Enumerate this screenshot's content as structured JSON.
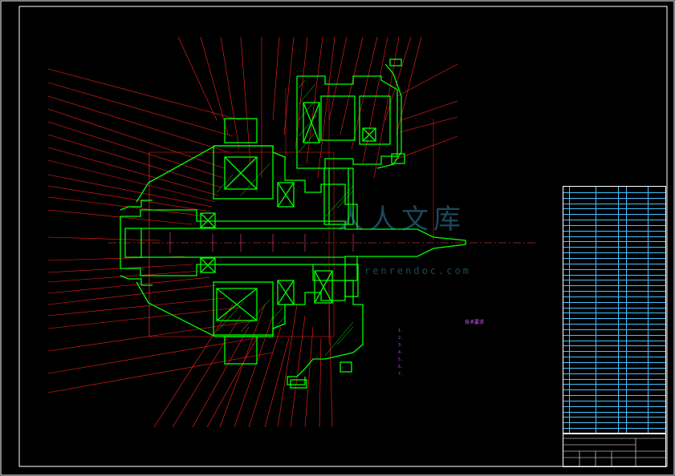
{
  "sheet": {
    "border_color": "#ffffff",
    "geometry_color": "#00ff00",
    "leader_color": "#ff2020",
    "table_line_color": "#48c0ff"
  },
  "notes": {
    "title": "技术要求",
    "lines": [
      "1.",
      "2.",
      "3.",
      "4.",
      "5.",
      "6.",
      "7."
    ]
  },
  "watermark": {
    "text": "人人文库",
    "url": "renrendoc.com"
  },
  "title_block": {
    "name": "",
    "code": "",
    "code2": ""
  },
  "bom": {
    "rows": 45
  }
}
